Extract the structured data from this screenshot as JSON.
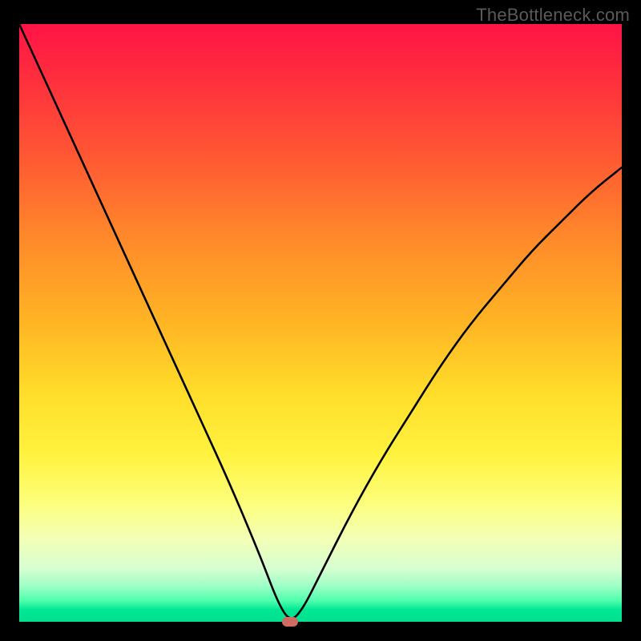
{
  "watermark": "TheBottleneck.com",
  "chart_data": {
    "type": "line",
    "title": "",
    "xlabel": "",
    "ylabel": "",
    "xlim": [
      0,
      100
    ],
    "ylim": [
      0,
      100
    ],
    "grid": false,
    "legend": false,
    "series": [
      {
        "name": "bottleneck-curve",
        "x": [
          0,
          5,
          10,
          15,
          20,
          25,
          30,
          35,
          40,
          43,
          45,
          47,
          50,
          55,
          60,
          65,
          70,
          75,
          80,
          85,
          90,
          95,
          100
        ],
        "y": [
          100,
          89,
          78,
          67,
          56,
          45,
          34,
          23,
          11,
          3,
          0,
          2,
          8,
          18,
          27,
          35,
          43,
          50,
          56,
          62,
          67,
          72,
          76
        ]
      }
    ],
    "marker": {
      "x": 45,
      "y": 0
    },
    "colors": {
      "gradient_top": "#ff1446",
      "gradient_mid": "#ffde2a",
      "gradient_bottom": "#00e08e",
      "curve": "#000000",
      "marker": "#cf6b63",
      "frame": "#000000"
    }
  }
}
